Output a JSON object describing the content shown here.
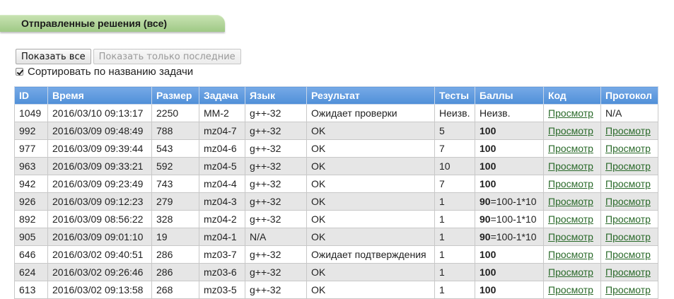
{
  "section_title": "Отправленные решения (все)",
  "buttons": {
    "show_all": "Показать все",
    "show_last": "Показать только последние"
  },
  "sort_checkbox": {
    "label": "Сортировать по названию задачи",
    "checked": true
  },
  "table": {
    "headers": [
      "ID",
      "Время",
      "Размер",
      "Задача",
      "Язык",
      "Результат",
      "Тесты",
      "Баллы",
      "Код",
      "Протокол"
    ],
    "rows": [
      {
        "id": "1049",
        "time": "2016/03/10 09:13:17",
        "size": "2250",
        "task": "MM-2",
        "lang": "g++-32",
        "result": "Ожидает проверки",
        "tests": "Неизв.",
        "score_bold": "",
        "score_rest": "Неизв.",
        "code": "Просмотр",
        "protocol": "N/A"
      },
      {
        "id": "992",
        "time": "2016/03/09 09:48:49",
        "size": "788",
        "task": "mz04-7",
        "lang": "g++-32",
        "result": "OK",
        "tests": "5",
        "score_bold": "100",
        "score_rest": "",
        "code": "Просмотр",
        "protocol": "Просмотр"
      },
      {
        "id": "977",
        "time": "2016/03/09 09:39:44",
        "size": "543",
        "task": "mz04-6",
        "lang": "g++-32",
        "result": "OK",
        "tests": "7",
        "score_bold": "100",
        "score_rest": "",
        "code": "Просмотр",
        "protocol": "Просмотр"
      },
      {
        "id": "963",
        "time": "2016/03/09 09:33:21",
        "size": "592",
        "task": "mz04-5",
        "lang": "g++-32",
        "result": "OK",
        "tests": "10",
        "score_bold": "100",
        "score_rest": "",
        "code": "Просмотр",
        "protocol": "Просмотр"
      },
      {
        "id": "942",
        "time": "2016/03/09 09:23:49",
        "size": "743",
        "task": "mz04-4",
        "lang": "g++-32",
        "result": "OK",
        "tests": "7",
        "score_bold": "100",
        "score_rest": "",
        "code": "Просмотр",
        "protocol": "Просмотр"
      },
      {
        "id": "926",
        "time": "2016/03/09 09:12:23",
        "size": "279",
        "task": "mz04-3",
        "lang": "g++-32",
        "result": "OK",
        "tests": "1",
        "score_bold": "90",
        "score_rest": "=100-1*10",
        "code": "Просмотр",
        "protocol": "Просмотр"
      },
      {
        "id": "892",
        "time": "2016/03/09 08:56:22",
        "size": "328",
        "task": "mz04-2",
        "lang": "g++-32",
        "result": "OK",
        "tests": "1",
        "score_bold": "90",
        "score_rest": "=100-1*10",
        "code": "Просмотр",
        "protocol": "Просмотр"
      },
      {
        "id": "905",
        "time": "2016/03/09 09:01:10",
        "size": "19",
        "task": "mz04-1",
        "lang": "N/A",
        "result": "OK",
        "tests": "1",
        "score_bold": "90",
        "score_rest": "=100-1*10",
        "code": "Просмотр",
        "protocol": "Просмотр"
      },
      {
        "id": "646",
        "time": "2016/03/02 09:40:51",
        "size": "286",
        "task": "mz03-7",
        "lang": "g++-32",
        "result": "Ожидает подтверждения",
        "tests": "1",
        "score_bold": "100",
        "score_rest": "",
        "code": "Просмотр",
        "protocol": "Просмотр"
      },
      {
        "id": "624",
        "time": "2016/03/02 09:26:46",
        "size": "286",
        "task": "mz03-6",
        "lang": "g++-32",
        "result": "OK",
        "tests": "1",
        "score_bold": "100",
        "score_rest": "",
        "code": "Просмотр",
        "protocol": "Просмотр"
      },
      {
        "id": "613",
        "time": "2016/03/02 09:13:58",
        "size": "268",
        "task": "mz03-5",
        "lang": "g++-32",
        "result": "OK",
        "tests": "1",
        "score_bold": "100",
        "score_rest": "",
        "code": "Просмотр",
        "protocol": "Просмотр"
      }
    ]
  },
  "colors": {
    "header_bg": "#4f8fd8",
    "tab_bg": "#9fc986",
    "link": "#2a6a2a",
    "row_alt": "#e6e6e6"
  }
}
